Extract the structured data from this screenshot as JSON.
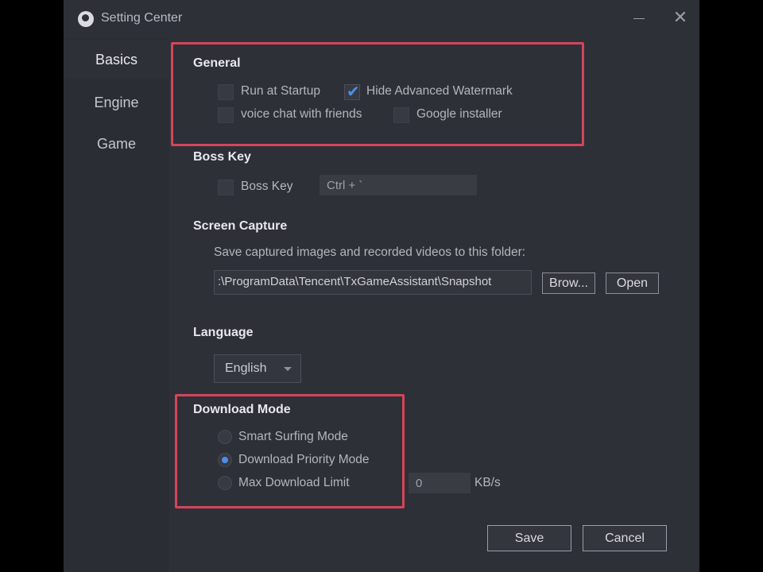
{
  "window": {
    "title": "Setting Center",
    "icons": {
      "app": "app-logo-icon",
      "minimize": "minimize-icon",
      "close": "close-icon"
    },
    "close_glyph": "✕"
  },
  "sidebar": {
    "items": [
      {
        "label": "Basics",
        "active": true
      },
      {
        "label": "Engine",
        "active": false
      },
      {
        "label": "Game",
        "active": false
      }
    ]
  },
  "general": {
    "title": "General",
    "options": [
      {
        "label": "Run at Startup",
        "checked": false
      },
      {
        "label": "Hide Advanced Watermark",
        "checked": true
      },
      {
        "label": "voice chat with friends",
        "checked": false
      },
      {
        "label": "Google installer",
        "checked": false
      }
    ],
    "check_glyph": "✔"
  },
  "boss_key": {
    "title": "Boss Key",
    "checkbox_label": "Boss Key",
    "checked": false,
    "shortcut_value": "Ctrl + `"
  },
  "screen_capture": {
    "title": "Screen Capture",
    "description": "Save captured images and recorded videos to this folder:",
    "folder_path": ":\\ProgramData\\Tencent\\TxGameAssistant\\Snapshot",
    "browse_label": "Brow...",
    "open_label": "Open"
  },
  "language": {
    "title": "Language",
    "selected": "English"
  },
  "download_mode": {
    "title": "Download Mode",
    "options": [
      {
        "label": "Smart Surfing Mode",
        "selected": false
      },
      {
        "label": "Download Priority Mode",
        "selected": true
      },
      {
        "label": "Max Download Limit",
        "selected": false
      }
    ],
    "limit_value": "0",
    "limit_unit": "KB/s"
  },
  "footer": {
    "save_label": "Save",
    "cancel_label": "Cancel"
  },
  "colors": {
    "accent": "#4b8fe6",
    "highlight_box": "#d4455a",
    "background": "#2e3038"
  }
}
